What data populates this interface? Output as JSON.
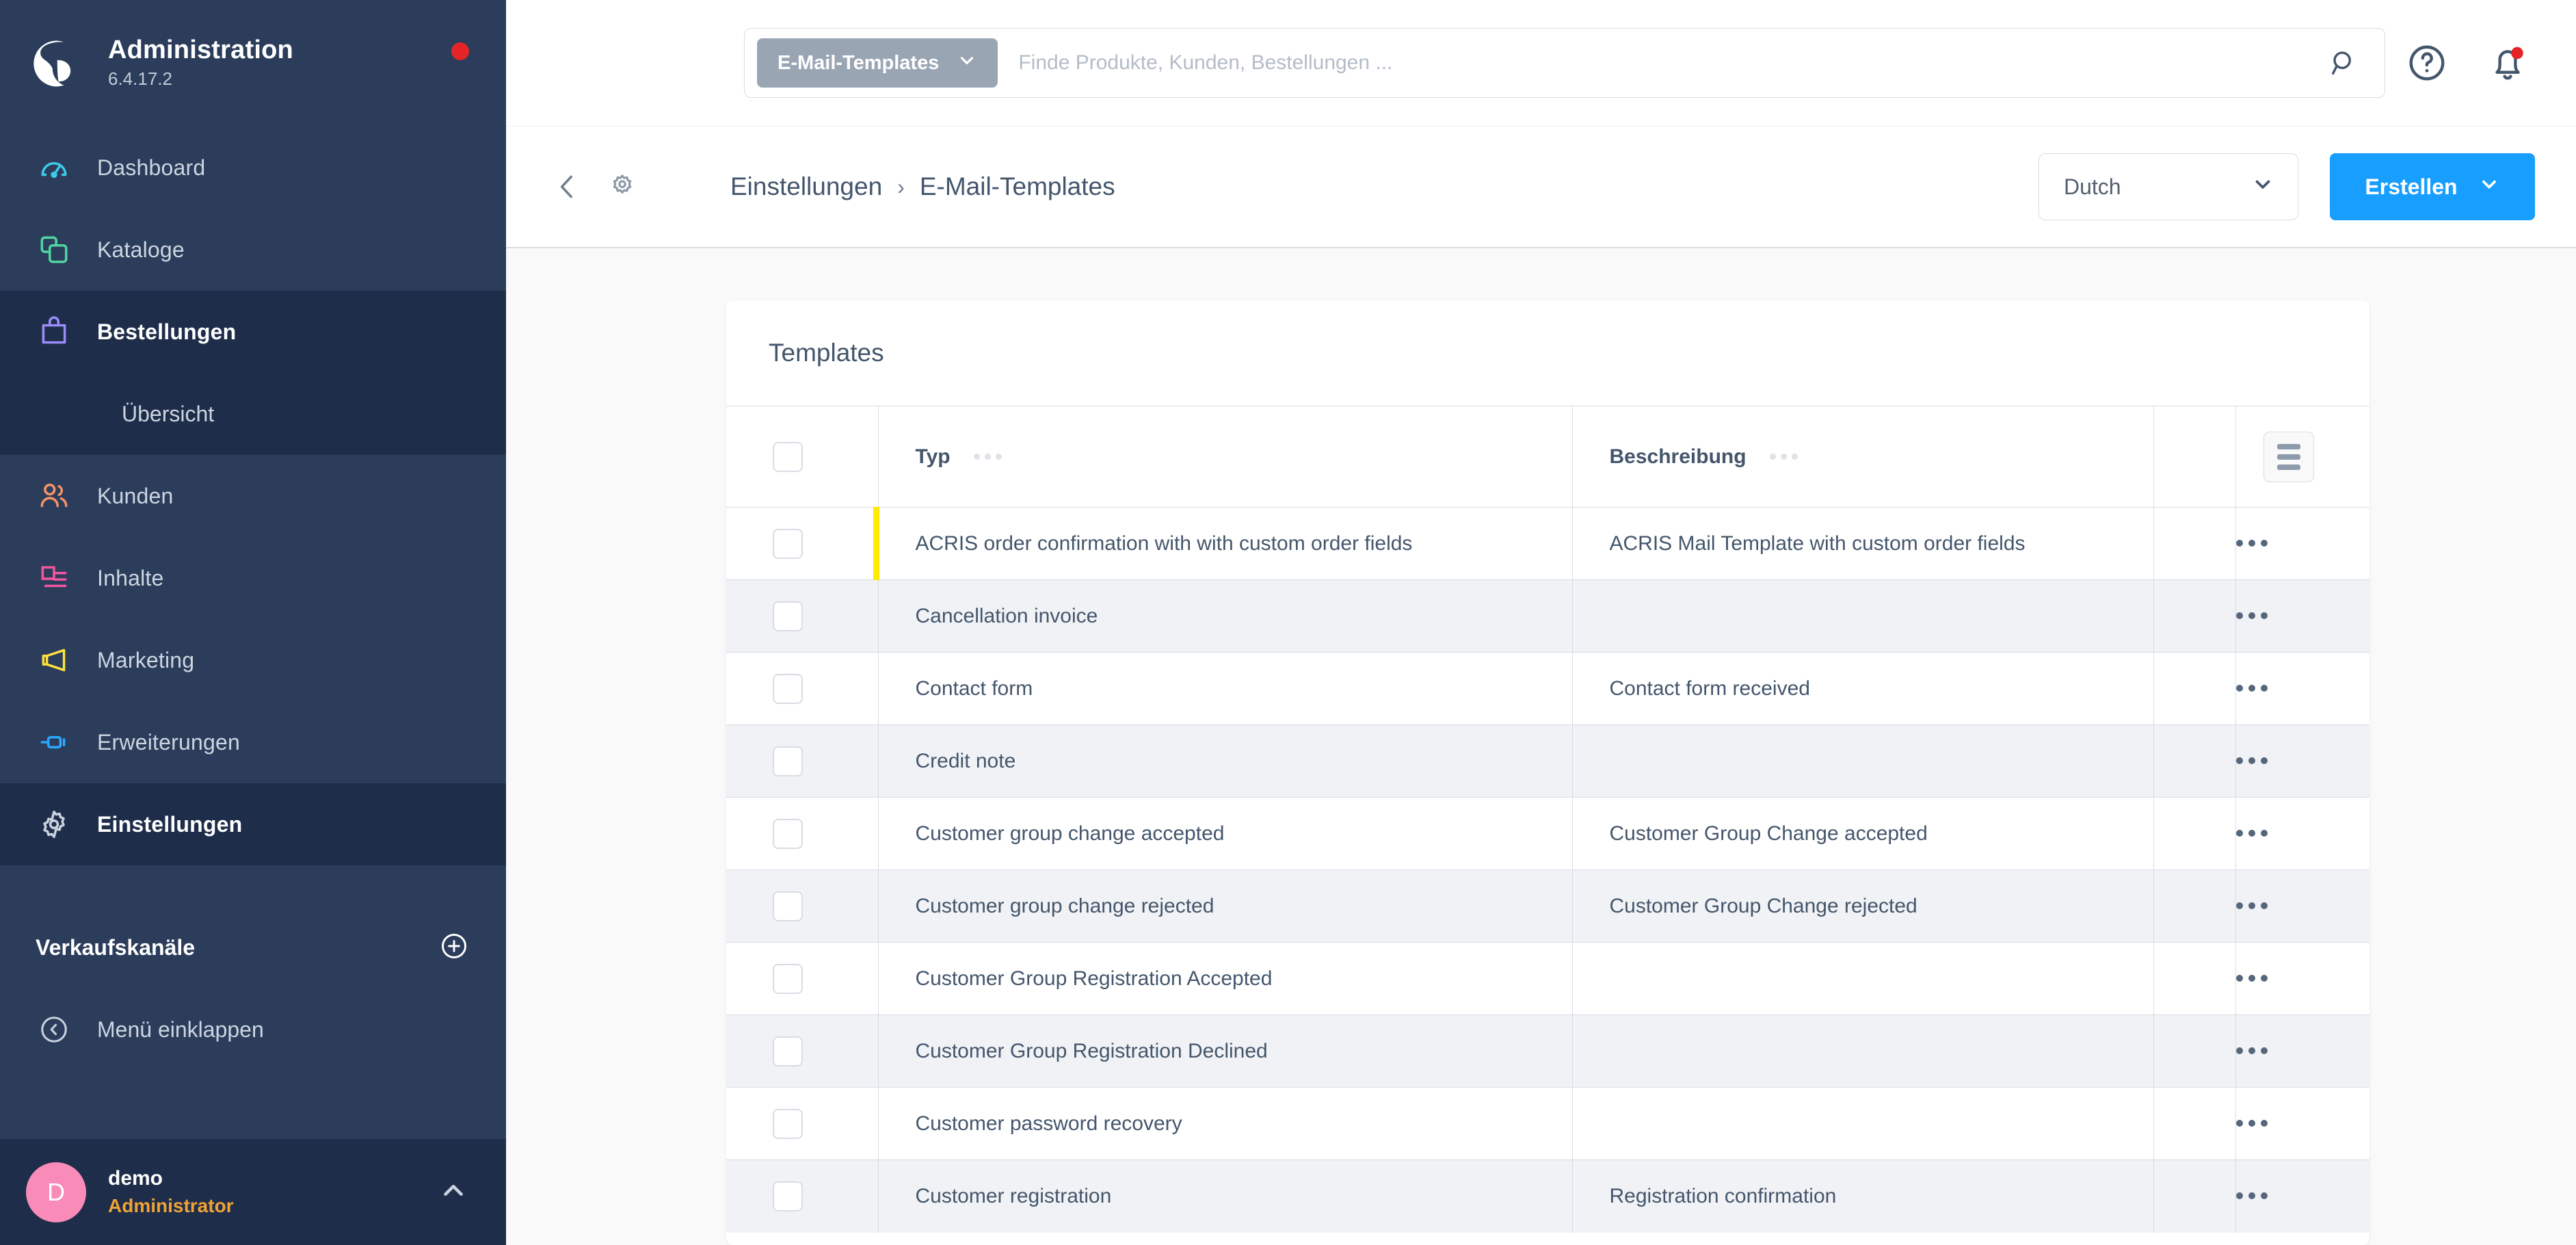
{
  "sidebar": {
    "brand": {
      "title": "Administration",
      "version": "6.4.17.2"
    },
    "items": [
      {
        "label": "Dashboard",
        "icon": "gauge-icon",
        "color": "#3ecbe8",
        "active": false
      },
      {
        "label": "Kataloge",
        "icon": "catalog-icon",
        "color": "#4fd6a0",
        "active": false
      },
      {
        "label": "Bestellungen",
        "icon": "bag-icon",
        "color": "#9b8cfb",
        "active": true
      },
      {
        "label": "Kunden",
        "icon": "users-icon",
        "color": "#f79268",
        "active": false
      },
      {
        "label": "Inhalte",
        "icon": "content-icon",
        "color": "#f2569f",
        "active": false
      },
      {
        "label": "Marketing",
        "icon": "megaphone-icon",
        "color": "#ffe03f",
        "active": false
      },
      {
        "label": "Erweiterungen",
        "icon": "plugin-icon",
        "color": "#2aa8ff",
        "active": false
      },
      {
        "label": "Einstellungen",
        "icon": "gear-icon",
        "color": "#c9d2de",
        "active": true
      }
    ],
    "submenu": {
      "parent": "Bestellungen",
      "label": "Übersicht"
    },
    "sales_channels": {
      "title": "Verkaufskanäle",
      "add_label": "+"
    },
    "collapse": {
      "label": "Menü einklappen"
    },
    "user": {
      "initial": "D",
      "name": "demo",
      "role": "Administrator"
    }
  },
  "topbar": {
    "search_scope": "E-Mail-Templates",
    "search_placeholder": "Finde Produkte, Kunden, Bestellungen ...",
    "search_value": "",
    "help_icon": "question-circle-icon",
    "notifications_icon": "bell-icon",
    "has_notification": true
  },
  "smartbar": {
    "back_icon": "chevron-left-icon",
    "gear_icon": "gear-icon",
    "breadcrumb": {
      "parent": "Einstellungen",
      "separator": "›",
      "current": "E-Mail-Templates"
    },
    "language": "Dutch",
    "create_label": "Erstellen"
  },
  "card": {
    "title": "Templates",
    "columns": {
      "typ": "Typ",
      "beschreibung": "Beschreibung"
    },
    "rows": [
      {
        "typ": "ACRIS order confirmation with with custom order fields",
        "beschreibung": "ACRIS Mail Template with custom order fields",
        "flag": "#ffea00"
      },
      {
        "typ": "Cancellation invoice",
        "beschreibung": "",
        "flag": ""
      },
      {
        "typ": "Contact form",
        "beschreibung": "Contact form received",
        "flag": ""
      },
      {
        "typ": "Credit note",
        "beschreibung": "",
        "flag": ""
      },
      {
        "typ": "Customer group change accepted",
        "beschreibung": "Customer Group Change accepted",
        "flag": ""
      },
      {
        "typ": "Customer group change rejected",
        "beschreibung": "Customer Group Change rejected",
        "flag": ""
      },
      {
        "typ": "Customer Group Registration Accepted",
        "beschreibung": "",
        "flag": ""
      },
      {
        "typ": "Customer Group Registration Declined",
        "beschreibung": "",
        "flag": ""
      },
      {
        "typ": "Customer password recovery",
        "beschreibung": "",
        "flag": ""
      },
      {
        "typ": "Customer registration",
        "beschreibung": "Registration confirmation",
        "flag": ""
      }
    ]
  },
  "colors": {
    "sidebar_bg": "#2b3d5b",
    "sidebar_active": "#1e2d4a",
    "primary": "#189eff",
    "text": "#44566c",
    "notification": "#e52427",
    "avatar": "#f88bb8",
    "role": "#f0a335"
  }
}
